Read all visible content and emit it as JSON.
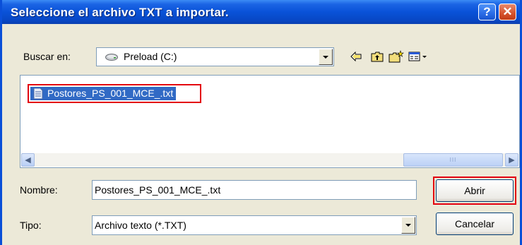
{
  "dialog": {
    "title": "Seleccione el archivo TXT a importar.",
    "help_button": "?",
    "close_button": "✕"
  },
  "lookin": {
    "label": "Buscar en:",
    "value": "Preload (C:)",
    "drive_icon": "drive-icon"
  },
  "toolbar": {
    "back_icon": "back-arrow-icon",
    "up_icon": "up-folder-icon",
    "newfolder_icon": "new-folder-icon",
    "view_icon": "view-menu-icon"
  },
  "files": [
    {
      "name": "Postores_PS_001_MCE_.txt",
      "icon": "text-file-icon",
      "selected": true
    }
  ],
  "scrollbar": {
    "thumb_grip": "III"
  },
  "filename": {
    "label": "Nombre:",
    "value": "Postores_PS_001_MCE_.txt"
  },
  "filetype": {
    "label": "Tipo:",
    "value": "Archivo texto (*.TXT)"
  },
  "buttons": {
    "open": "Abrir",
    "cancel": "Cancelar"
  },
  "colors": {
    "titlebar": "#0a52d8",
    "selection": "#316ac5",
    "highlight_box": "#e3000f",
    "face": "#ece9d8"
  }
}
